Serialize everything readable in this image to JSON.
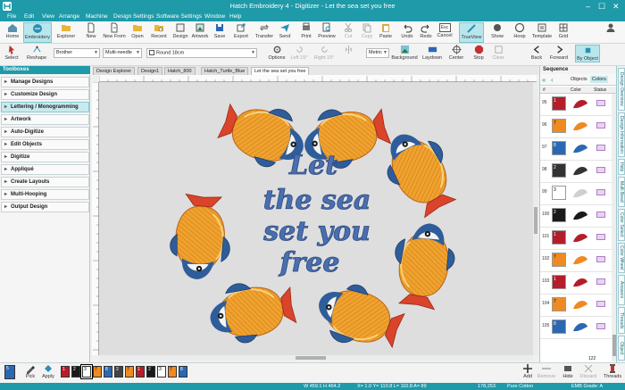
{
  "window": {
    "title": "Hatch Embroidery 4 - Digitizer - Let the sea set you free"
  },
  "menu": [
    "File",
    "Edit",
    "View",
    "Arrange",
    "Machine",
    "Design Settings",
    "Software Settings",
    "Window",
    "Help"
  ],
  "ribbon": [
    {
      "label": "Home"
    },
    {
      "label": "Embroidery",
      "active": true
    },
    {
      "label": "Explorer"
    },
    {
      "label": "New"
    },
    {
      "label": "New From"
    },
    {
      "label": "Open"
    },
    {
      "label": "Recent"
    },
    {
      "label": "Design"
    },
    {
      "label": "Artwork"
    },
    {
      "label": "Save"
    },
    {
      "label": "Export"
    },
    {
      "label": "Transfer"
    },
    {
      "label": "Send"
    },
    {
      "label": "Print"
    },
    {
      "label": "Preview"
    },
    {
      "label": "Cut"
    },
    {
      "label": "Copy"
    },
    {
      "label": "Paste"
    },
    {
      "label": "Undo"
    },
    {
      "label": "Redo"
    },
    {
      "label": "Cancel"
    },
    {
      "label": "TrueView",
      "active": true
    },
    {
      "label": "Show"
    },
    {
      "label": "Hoop"
    },
    {
      "label": "Template"
    },
    {
      "label": "Grid"
    }
  ],
  "escape_key": "Esc",
  "propbar": {
    "select": "Select",
    "reshape": "Reshape",
    "brand": "Brother",
    "needle": "Multi-needle",
    "hoop": "Round 18cm",
    "options": "Options",
    "left": "Left 15°",
    "right": "Right 15°",
    "units": "Metric",
    "background": "Background",
    "laydown": "Laydown",
    "center": "Center",
    "stop": "Stop",
    "clear": "Clear",
    "back": "Back",
    "forward": "Forward",
    "by_object": "By Object"
  },
  "toolboxes": {
    "title": "Toolboxes",
    "items": [
      "Manage Designs",
      "Customize Design",
      "Lettering / Monogramming",
      "Artwork",
      "Auto-Digitize",
      "Edit Objects",
      "Digitize",
      "Appliqué",
      "Create Layouts",
      "Multi-Hooping",
      "Output Design"
    ],
    "selected": "Lettering / Monogramming"
  },
  "doc_tabs": [
    "Design Explorer",
    "Design1",
    "Hatch_800",
    "Hatch_Turtle_Blue",
    "Let the sea set you free"
  ],
  "active_tab": "Let the sea set you free",
  "design_text": [
    "Let",
    "the sea",
    "set you",
    "free"
  ],
  "sequence": {
    "title": "Sequence",
    "tabs": [
      "Objects",
      "Colors"
    ],
    "active_tab": "Colors",
    "cols": [
      "#",
      "Color",
      "Status"
    ],
    "rows": [
      {
        "num": "95",
        "swatch": "#b41e2b",
        "code": "1"
      },
      {
        "num": "96",
        "swatch": "#ef8a22",
        "code": "7"
      },
      {
        "num": "97",
        "swatch": "#2a68b4",
        "code": "8"
      },
      {
        "num": "98",
        "swatch": "#333333",
        "code": "2"
      },
      {
        "num": "99",
        "swatch": "#ffffff",
        "code": "3"
      },
      {
        "num": "100",
        "swatch": "#1a1a1a",
        "code": "2"
      },
      {
        "num": "101",
        "swatch": "#b41e2b",
        "code": "1"
      },
      {
        "num": "102",
        "swatch": "#ef8a22",
        "code": "7"
      },
      {
        "num": "103",
        "swatch": "#b41e2b",
        "code": "1"
      },
      {
        "num": "104",
        "swatch": "#ef8a22",
        "code": "7"
      },
      {
        "num": "105",
        "swatch": "#2a68b4",
        "code": "8"
      }
    ]
  },
  "side_tabs": [
    "Design Overview",
    "Design Information",
    "Help",
    "Multi Bead",
    "Color Select",
    "Color Wheel",
    "Answers",
    "Threads",
    "Object"
  ],
  "palette": [
    {
      "code": "5",
      "color": "#2a68b4"
    },
    {
      "code": "1",
      "color": "#b41e2b"
    },
    {
      "code": "2",
      "color": "#1a1a1a"
    },
    {
      "code": "3",
      "color": "#ffffff"
    },
    {
      "code": "7",
      "color": "#ef8a22"
    },
    {
      "code": "8",
      "color": "#2a68b4"
    },
    {
      "code": "2",
      "color": "#444444"
    },
    {
      "code": "7",
      "color": "#ef8a22"
    },
    {
      "code": "1",
      "color": "#b41e2b"
    },
    {
      "code": "2",
      "color": "#1a1a1a"
    },
    {
      "code": "3",
      "color": "#ffffff"
    },
    {
      "code": "7",
      "color": "#ef8a22"
    },
    {
      "code": "8",
      "color": "#2a68b4"
    }
  ],
  "bottom": {
    "pick": "Pick",
    "apply": "Apply",
    "add": "Add",
    "remove": "Remove",
    "hide": "Hide",
    "discard": "Discard",
    "threads": "Threads",
    "count": "122",
    "count2": "91"
  },
  "status": {
    "size": "W 459.1 H 464.2",
    "coords": "X= 1.0 Y= 110.8 L= 110.8 A= 89",
    "stitches": "178,253",
    "thread": "Pure Cotton",
    "grade": "EMB Grade: A"
  }
}
